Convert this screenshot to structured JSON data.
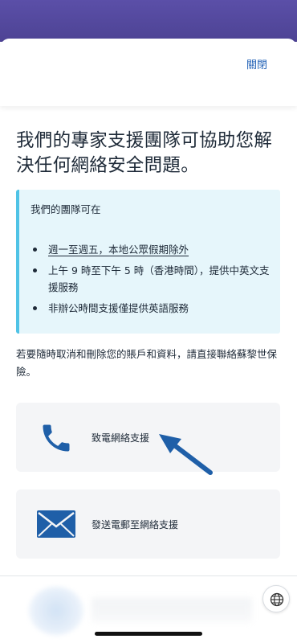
{
  "header": {
    "close_label": "關閉"
  },
  "headline": "我們的專家支援團隊可協助您解決任何網絡安全問題。",
  "info_box": {
    "title": "我們的團隊可在",
    "items": [
      "週一至週五，本地公眾假期除外",
      "上午 9 時至下午 5 時（香港時間），提供中英文支援服務",
      "非辦公時間支援僅提供英語服務"
    ]
  },
  "note": "若要隨時取消和刪除您的賬戶和資料，請直接聯絡蘇黎世保險。",
  "contact_options": {
    "phone_label": "致電網絡支援",
    "email_label": "發送電郵至網絡支援"
  },
  "icons": {
    "phone": "phone-icon",
    "email": "envelope-icon",
    "globe": "globe-icon",
    "arrow": "arrow-pointer-icon"
  },
  "colors": {
    "accent": "#2463b7",
    "icon_blue": "#1f5fa8",
    "info_bg": "#e6f6fb",
    "info_border": "#4fc3e6",
    "card_bg": "#f4f5f7",
    "top_band": "#5b4fa8"
  }
}
